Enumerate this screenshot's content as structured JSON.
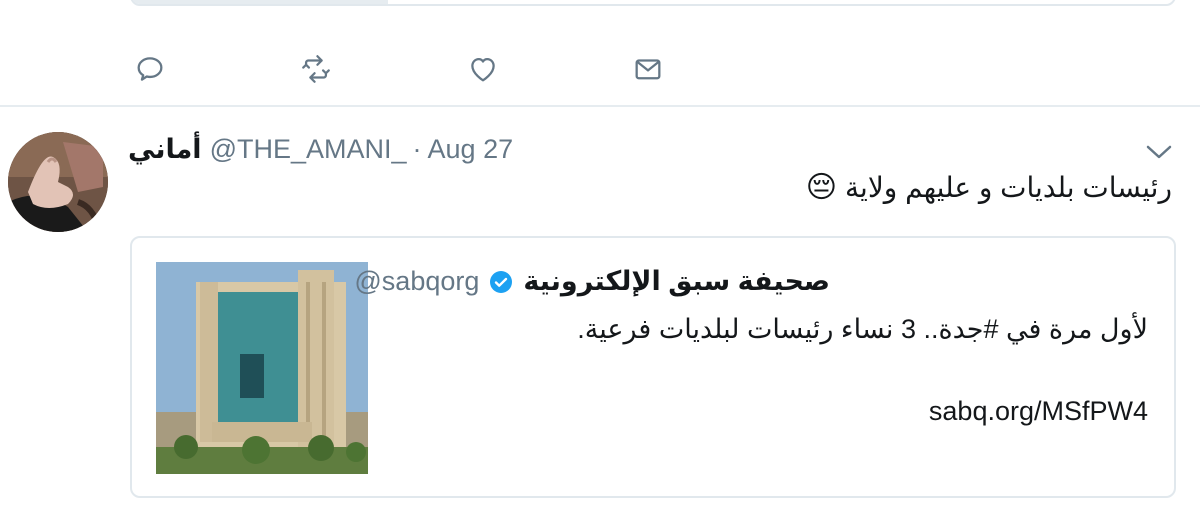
{
  "previous_tweet": {
    "actions": {
      "reply_icon": "reply-icon",
      "retweet_icon": "retweet-icon",
      "like_icon": "heart-icon",
      "dm_icon": "envelope-icon"
    }
  },
  "tweet": {
    "display_name": "أماني",
    "handle": "@THE_AMANI_",
    "separator": "·",
    "timestamp": "Aug 27",
    "text": "رئيسات بلديات و عليهم ولاية",
    "emoji": "😔",
    "menu_icon": "chevron-down-icon",
    "quote": {
      "display_name": "صحيفة سبق الإلكترونية",
      "verified_icon": "verified-badge-icon",
      "handle": "@sabqorg",
      "text": "لأول مرة في #جدة.. 3 نساء رئيسات لبلديات فرعية.",
      "link": "sabq.org/MSfPW4"
    }
  },
  "colors": {
    "icon_gray": "#657786",
    "text": "#14171a",
    "border": "#e1e8ed",
    "verified_blue": "#1da1f2",
    "building_glass": "#3f8f93",
    "building_stone": "#d8c8a6",
    "sky": "#8fb3d3"
  }
}
